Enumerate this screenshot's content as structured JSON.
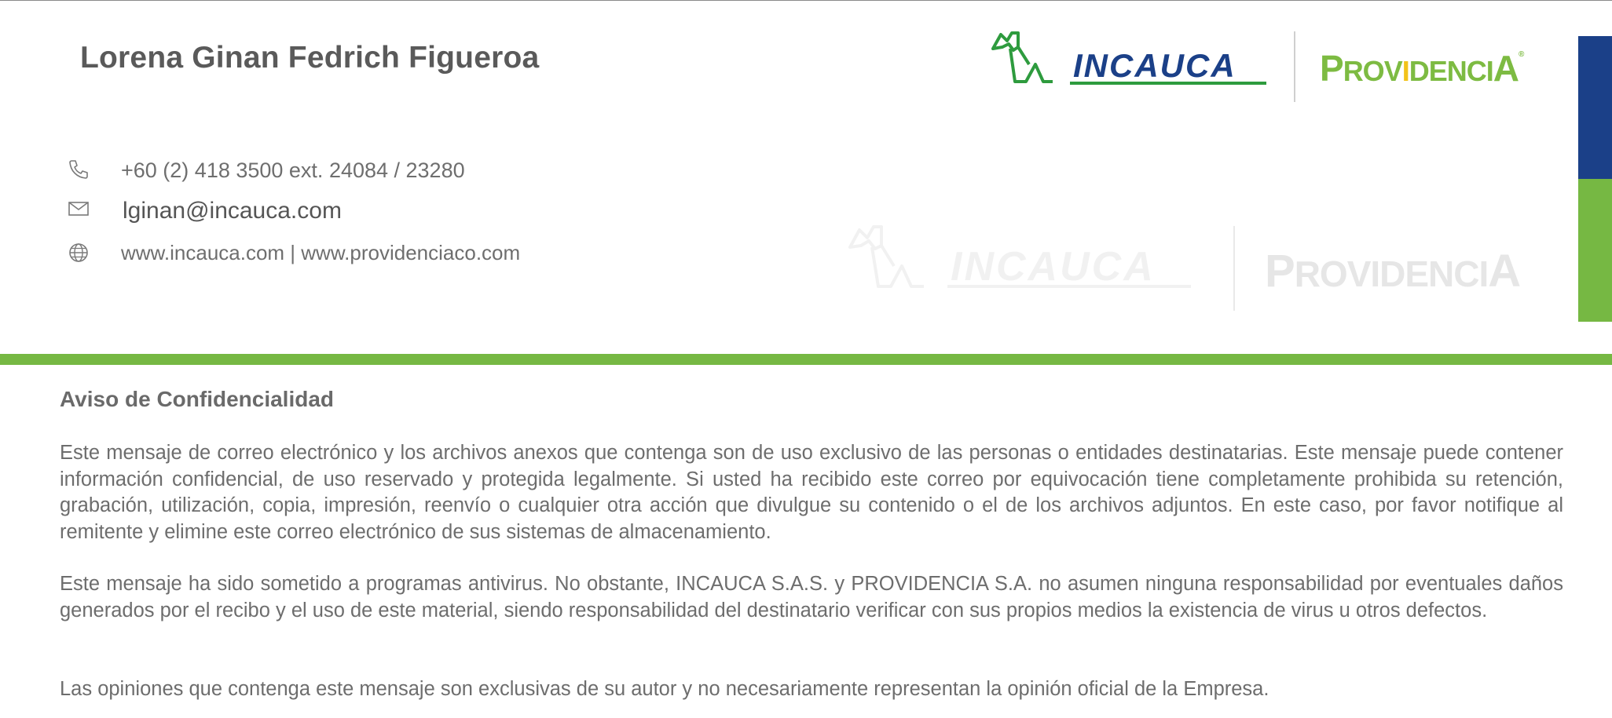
{
  "signature": {
    "name": "Lorena Ginan Fedrich Figueroa",
    "phone": "+60 (2) 418 3500 ext. 24084 / 23280",
    "email": "lginan@incauca.com",
    "websites": "www.incauca.com  | www.providenciaco.com",
    "icons": {
      "phone": "phone-icon",
      "email": "envelope-icon",
      "web": "globe-icon"
    }
  },
  "logos": {
    "incauca": "INCAUCA",
    "providencia": {
      "part1": "P",
      "part2": "ROV",
      "part3": "I",
      "part4": "DENCI",
      "part5": "A",
      "registered": "®"
    }
  },
  "colors": {
    "brand_blue": "#1b4088",
    "brand_green": "#76b843",
    "accent_yellow": "#f2c21a",
    "text_gray": "#6d6d6d"
  },
  "notice": {
    "title": "Aviso de Confidencialidad",
    "paragraph1": "Este mensaje de correo electrónico y los archivos anexos que contenga son de uso exclusivo de las personas o entidades destinatarias. Este mensaje puede contener información confidencial, de uso reservado y protegida legalmente. Si usted ha recibido este correo por equivocación tiene completamente prohibida su retención, grabación, utilización, copia, impresión, reenvío o cualquier otra acción que divulgue su contenido o el de los archivos adjuntos. En este caso, por favor notifique al remitente y elimine este correo electrónico de sus sistemas de almacenamiento.",
    "paragraph2": "Este mensaje ha sido sometido a programas antivirus. No obstante, INCAUCA S.A.S. y PROVIDENCIA S.A. no asumen ninguna responsabilidad por eventuales daños generados por el recibo y el uso de este material, siendo responsabilidad del destinatario verificar con sus propios medios la existencia de virus u otros defectos.",
    "paragraph3": "Las opiniones que contenga este mensaje son exclusivas de su autor y no necesariamente representan la opinión oficial de la Empresa."
  }
}
